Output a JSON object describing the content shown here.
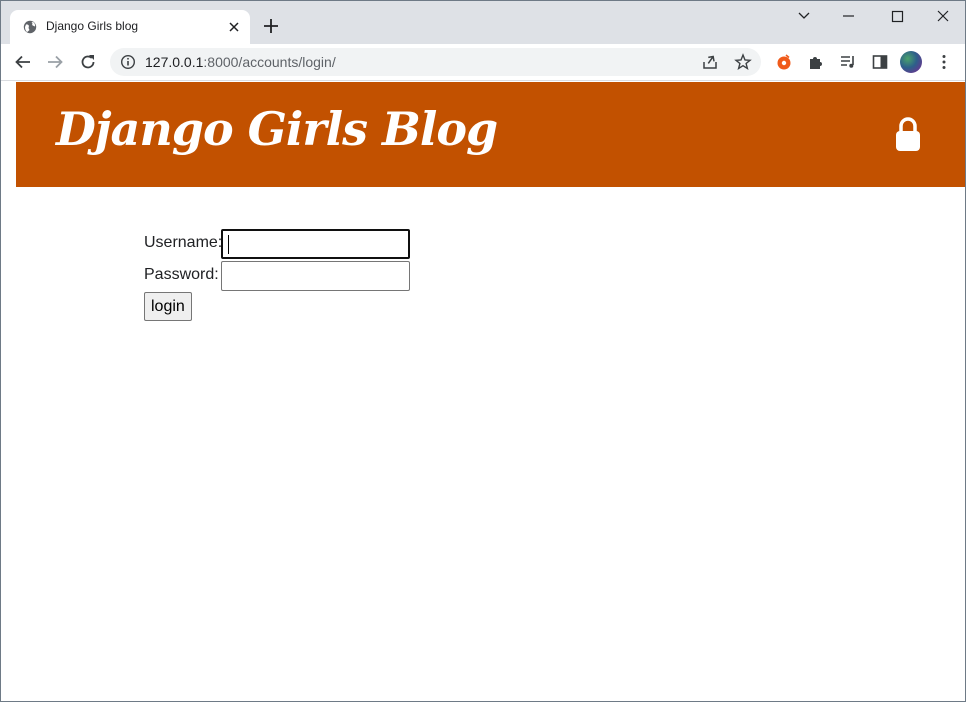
{
  "browser": {
    "tab_title": "Django Girls blog",
    "url_host": "127.0.0.1",
    "url_path": ":8000/accounts/login/"
  },
  "header": {
    "blog_title": "Django Girls Blog",
    "brand_color": "#c25100"
  },
  "form": {
    "username_label": "Username:",
    "username_value": "",
    "password_label": "Password:",
    "password_value": "",
    "login_label": "login"
  },
  "icons": [
    "globe-icon",
    "close-icon",
    "plus-icon",
    "chevron-down-icon",
    "minimize-icon",
    "maximize-icon",
    "window-close-icon",
    "back-arrow-icon",
    "forward-arrow-icon",
    "reload-icon",
    "info-icon",
    "share-icon",
    "star-icon",
    "extension-icon",
    "puzzle-icon",
    "media-queue-icon",
    "side-panel-icon",
    "menu-dots-icon",
    "lock-icon"
  ]
}
